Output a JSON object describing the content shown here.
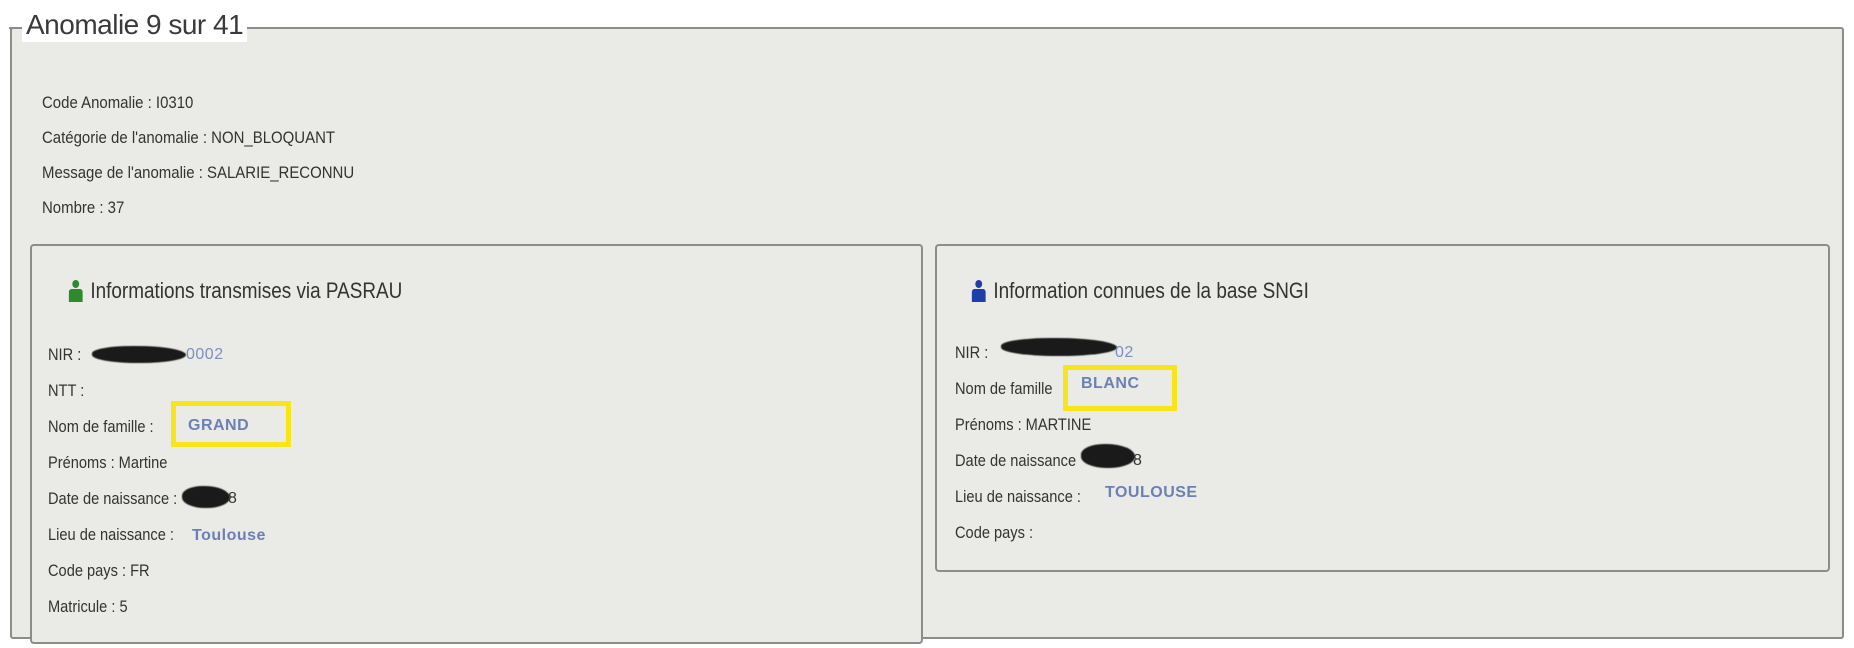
{
  "title": "Anomalie 9 sur 41",
  "summary": {
    "code": "Code Anomalie : I0310",
    "categorie": "Catégorie de l'anomalie : NON_BLOQUANT",
    "message": "Message de l'anomalie : SALARIE_RECONNU",
    "nombre": "Nombre : 37"
  },
  "left_panel": {
    "title": "Informations transmises via PASRAU",
    "icon": "user-icon",
    "icon_color": "#2e8a2e",
    "nir_label": "NIR :",
    "nir_value_visible": "0002",
    "ntt_label": "NTT :",
    "nom_label": "Nom de famille :",
    "nom_value": "GRAND",
    "prenoms": "Prénoms : Martine",
    "date_label": "Date de naissance :",
    "date_value_visible": "8",
    "lieu_label": "Lieu de naissance :",
    "lieu_value": "Toulouse",
    "code_pays": "Code pays : FR",
    "matricule": "Matricule : 5"
  },
  "right_panel": {
    "title": "Information connues de la base SNGI",
    "icon": "user-icon",
    "icon_color": "#1f3fa8",
    "nir_label": "NIR :",
    "nir_value_visible": "02",
    "nom_label": "Nom de famille",
    "nom_value": "BLANC",
    "prenoms": "Prénoms : MARTINE",
    "date_label": "Date de naissance",
    "date_value_visible": "8",
    "lieu_label": "Lieu de naissance :",
    "lieu_value": "TOULOUSE",
    "code_pays": "Code pays :"
  },
  "colors": {
    "highlight": "#f7e51a",
    "value_text": "#6b80b5",
    "panel_bg": "#eaeae6"
  }
}
